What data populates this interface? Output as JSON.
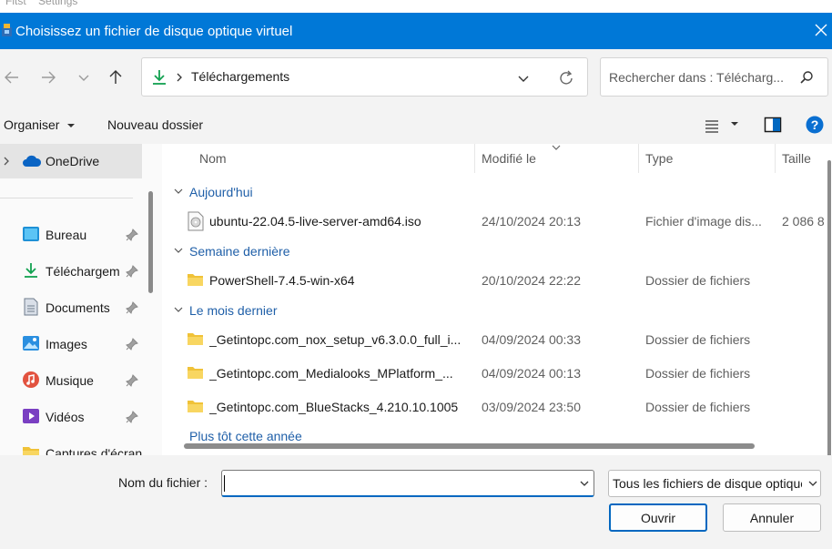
{
  "background_app": {
    "menu_items": [
      "Fitst",
      "Settings"
    ]
  },
  "dialog": {
    "title": "Choisissez un fichier de disque optique virtuel",
    "accent": "#0078d7"
  },
  "nav": {
    "address": {
      "current_folder": "Téléchargements"
    },
    "search": {
      "placeholder": "Rechercher dans : Télécharg..."
    }
  },
  "command_bar": {
    "organize": "Organiser",
    "new_folder": "Nouveau dossier"
  },
  "sidebar": {
    "selected": "OneDrive",
    "quick_access": [
      {
        "label": "Bureau",
        "icon": "desktop-icon"
      },
      {
        "label": "Téléchargem",
        "icon": "download-icon"
      },
      {
        "label": "Documents",
        "icon": "documents-icon"
      },
      {
        "label": "Images",
        "icon": "images-icon"
      },
      {
        "label": "Musique",
        "icon": "music-icon"
      },
      {
        "label": "Vidéos",
        "icon": "videos-icon"
      },
      {
        "label": "Captures d'écran",
        "icon": "folder-icon"
      }
    ]
  },
  "file_list": {
    "columns": [
      "Nom",
      "Modifié le",
      "Type",
      "Taille"
    ],
    "groups": [
      {
        "label": "Aujourd'hui",
        "rows": [
          {
            "name": "ubuntu-22.04.5-live-server-amd64.iso",
            "modified": "24/10/2024 20:13",
            "type": "Fichier d'image dis...",
            "size": "2 086 8",
            "icon": "disc-image-icon"
          }
        ]
      },
      {
        "label": "Semaine dernière",
        "rows": [
          {
            "name": "PowerShell-7.4.5-win-x64",
            "modified": "20/10/2024 22:22",
            "type": "Dossier de fichiers",
            "size": "",
            "icon": "folder-icon"
          }
        ]
      },
      {
        "label": "Le mois dernier",
        "rows": [
          {
            "name": "_Getintopc.com_nox_setup_v6.3.0.0_full_i...",
            "modified": "04/09/2024 00:33",
            "type": "Dossier de fichiers",
            "size": "",
            "icon": "folder-icon"
          },
          {
            "name": "_Getintopc.com_Medialooks_MPlatform_...",
            "modified": "04/09/2024 00:13",
            "type": "Dossier de fichiers",
            "size": "",
            "icon": "folder-icon"
          },
          {
            "name": "_Getintopc.com_BlueStacks_4.210.10.1005",
            "modified": "03/09/2024 23:50",
            "type": "Dossier de fichiers",
            "size": "",
            "icon": "folder-icon"
          }
        ]
      },
      {
        "label": "Plus tôt cette année",
        "rows": []
      }
    ]
  },
  "bottom": {
    "filename_label": "Nom du fichier :",
    "filename_value": "",
    "filter_value": "Tous les fichiers de disque optique virtuel",
    "open_label": "Ouvrir",
    "cancel_label": "Annuler"
  }
}
